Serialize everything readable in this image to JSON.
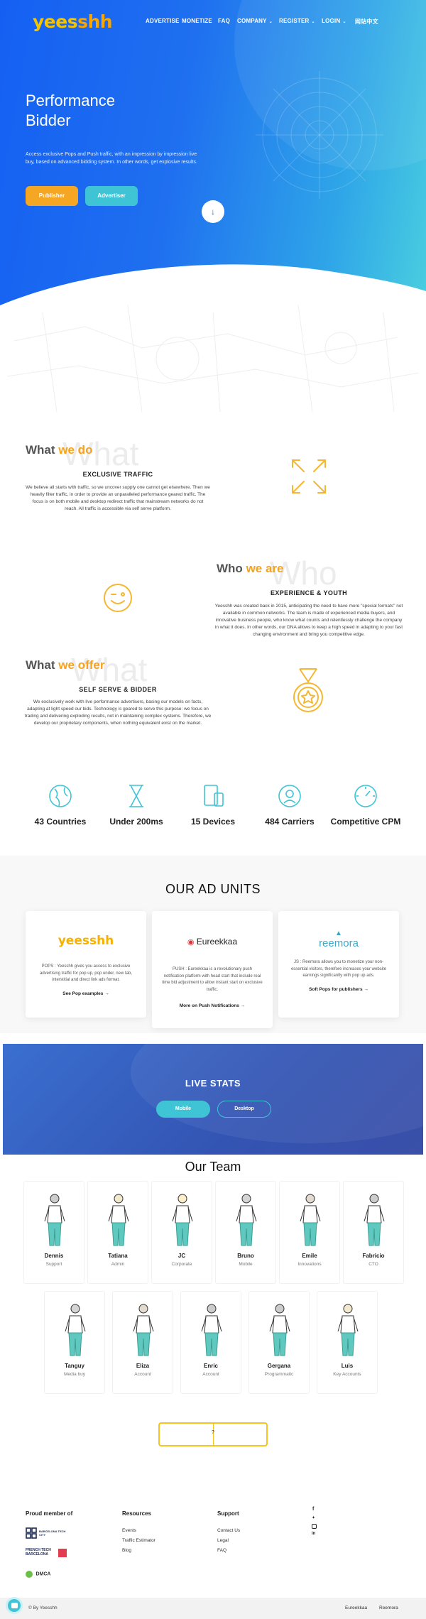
{
  "nav": {
    "logo_part1": "yees",
    "logo_part2": "shh",
    "items": [
      {
        "label": "ADVERTISE",
        "chevron": false
      },
      {
        "label": "MONETIZE",
        "chevron": false
      },
      {
        "label": "FAQ",
        "chevron": false
      },
      {
        "label": "COMPANY",
        "chevron": true
      },
      {
        "label": "REGISTER",
        "chevron": true
      },
      {
        "label": "LOGIN",
        "chevron": true
      },
      {
        "label": "网站中文",
        "chevron": false
      }
    ]
  },
  "hero": {
    "title_line1": "Performance",
    "title_line2": "Bidder",
    "description": "Access exclusive Pops and Push traffic, with an impression by impression live buy, based on advanced bidding system. In other words, get explosive results.",
    "publisher_button": "Publisher",
    "advertiser_button": "Advertiser",
    "scroll_icon": "arrow-down-icon"
  },
  "what_we_do": {
    "title_a": "What",
    "title_b": "we do",
    "ghost": "What",
    "subtitle": "EXCLUSIVE TRAFFIC",
    "text": "We believe all starts with traffic, so we uncover supply one cannot get elsewhere. Then we heavily filter traffic, in order to provide an unparalleled performance geared traffic. The focus is on both mobile and desktop redirect traffic that mainstream networks do not reach. All traffic is accessible via self serve platform.",
    "icon": "expand-arrows-icon"
  },
  "who_we_are": {
    "title_a": "Who",
    "title_b": "we are",
    "ghost": "Who",
    "subtitle": "EXPERIENCE & YOUTH",
    "text": "Yeesshh was created back in 2015, anticipating the need to have more \"special formats\" not available in common networks. The team is made of experienced media buyers, and innovative business people, who  know what counts and relentlessly challenge the company in what it does. In other words, our DNA allows to keep a high speed in adapting to your fast changing environment and bring you competitive edge.",
    "icon": "wink-smiley-icon"
  },
  "what_we_offer": {
    "title_a": "What",
    "title_b": "we offer",
    "ghost": "What",
    "subtitle": "SELF SERVE & BIDDER",
    "text": "We exclusively work with live performance advertisers, basing our models on facts, adapting at light speed our bids. Technology is geared to serve this purpose: we focus on trading and delivering exploding results, not in maintaining complex systems. Therefore, we develop our proprietary components, when nothing equivalent exist on the market.",
    "icon": "medal-icon"
  },
  "stats": [
    {
      "label": "43 Countries",
      "icon": "globe-icon"
    },
    {
      "label": "Under 200ms",
      "icon": "hourglass-icon"
    },
    {
      "label": "15 Devices",
      "icon": "devices-icon"
    },
    {
      "label": "484 Carriers",
      "icon": "signal-icon"
    },
    {
      "label": "Competitive CPM",
      "icon": "gauge-icon"
    }
  ],
  "ad_units": {
    "title": "OUR AD UNITS",
    "cards": [
      {
        "brand": "yeesshh",
        "text": "POPS : Yeesshh gives you access to exclusive advertising traffic for pop up, pop under, new tab, interstitial and direct link ads format.",
        "link": "See Pop examples"
      },
      {
        "brand": "Eureekkaa",
        "text": "PUSH : Eureekkaa is a revolutionary push notification platform with head start that include real time bid adjustment to allow instant start on exclusive traffic.",
        "link": "More on Push Notifications"
      },
      {
        "brand": "reemora",
        "text": "JS : Reemora allows you to monetize your non-essential visitors, therefore increases your website earnings significantly with pop up ads.",
        "link": "Soft Pops for publishers"
      }
    ]
  },
  "live_stats": {
    "title": "LIVE STATS",
    "mobile_button": "Mobile",
    "desktop_button": "Desktop"
  },
  "team": {
    "title": "Our Team",
    "row1": [
      {
        "name": "Dennis",
        "role": "Support"
      },
      {
        "name": "Tatiana",
        "role": "Admin"
      },
      {
        "name": "JC",
        "role": "Corporate"
      },
      {
        "name": "Bruno",
        "role": "Mobile"
      },
      {
        "name": "Emile",
        "role": "Innovations"
      },
      {
        "name": "Fabricio",
        "role": "CTO"
      }
    ],
    "row2": [
      {
        "name": "Tanguy",
        "role": "Media buy"
      },
      {
        "name": "Eliza",
        "role": "Account"
      },
      {
        "name": "Enric",
        "role": "Account"
      },
      {
        "name": "Gergana",
        "role": "Programmatic"
      },
      {
        "name": "Luis",
        "role": "Key Accounts"
      }
    ],
    "more_label": "?"
  },
  "footer": {
    "proud_title": "Proud member of",
    "logos": [
      "BARCELONA TECH CITY",
      "FRENCH TECH BARCELONA",
      "DMCA"
    ],
    "resources_title": "Resources",
    "resources": [
      "Events",
      "Traffic Estimator",
      "Blog"
    ],
    "support_title": "Support",
    "support": [
      "Contact Us",
      "Legal",
      "FAQ"
    ],
    "social": [
      "facebook-icon",
      "twitter-icon",
      "instagram-icon",
      "linkedin-icon"
    ],
    "copyright": "© By Yeesshh",
    "bottom_links": [
      "Eureekkaa",
      "Reemora"
    ]
  },
  "colors": {
    "primary_blue": "#1a62f2",
    "accent_orange": "#f7a21a",
    "accent_yellow": "#f5c400",
    "teal": "#3ec4d4",
    "live_stats_bg": "#3555b8"
  }
}
